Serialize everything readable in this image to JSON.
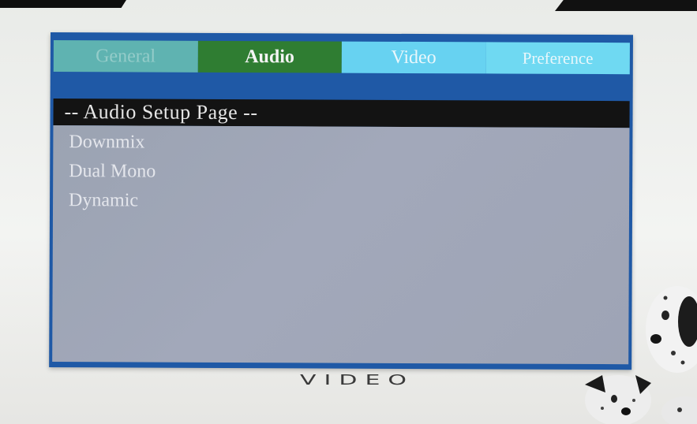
{
  "tabs": [
    {
      "label": "General"
    },
    {
      "label": "Audio"
    },
    {
      "label": "Video"
    },
    {
      "label": "Preference"
    }
  ],
  "active_tab": "Audio",
  "page_header": "-- Audio Setup Page --",
  "options": [
    {
      "label": "Downmix"
    },
    {
      "label": "Dual Mono"
    },
    {
      "label": "Dynamic"
    }
  ],
  "brand_text": "VIDEO",
  "colors": {
    "frame": "#1f59a6",
    "tab_general": "#5fb3b1",
    "tab_audio_active": "#2f7d32",
    "tab_video": "#67d2f1",
    "tab_preference": "#6fd9f2",
    "header_bar": "#131313",
    "options_panel": "#9ba3b2"
  },
  "icons": [
    "dalmatian-dogs-picture"
  ]
}
